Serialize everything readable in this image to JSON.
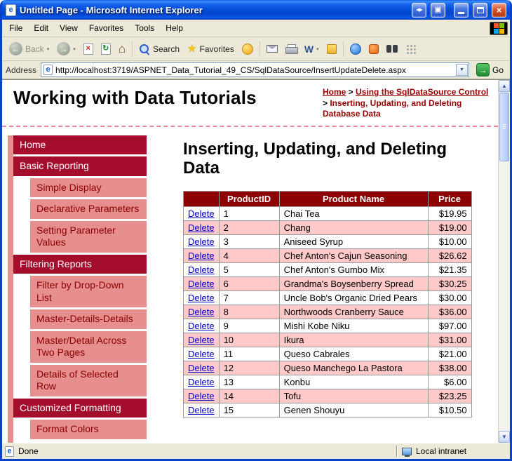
{
  "colors": {
    "titlebar_blue": "#0a50dc",
    "chrome_bg": "#ece9d8",
    "table_header_maroon": "#8b0000",
    "nav_header_red": "#a50d2d",
    "nav_sub_pink": "#e78f8f",
    "row_pink": "#ffc9c9",
    "breadcrumb_link": "#990000",
    "delete_link_blue": "#0000cc",
    "go_green": "#1e8c30"
  },
  "titlebar": {
    "title": "Untitled Page - Microsoft Internet Explorer"
  },
  "menu": {
    "items": [
      "File",
      "Edit",
      "View",
      "Favorites",
      "Tools",
      "Help"
    ]
  },
  "toolbar": {
    "back_label": "Back",
    "search_label": "Search",
    "favorites_label": "Favorites"
  },
  "address": {
    "label": "Address",
    "url": "http://localhost:3719/ASPNET_Data_Tutorial_49_CS/SqlDataSource/InsertUpdateDelete.aspx",
    "go_label": "Go"
  },
  "icons": {
    "favicon_letter": "e",
    "monitor_swap": "◀▶",
    "monitor": "▣",
    "close": "×",
    "back_arrow": "←",
    "forward_arrow": "→",
    "stop": "×",
    "refresh": "↻",
    "home": "⌂",
    "star": "★",
    "word": "W",
    "chevron_down": "▾",
    "dropdown_arrow": "▼",
    "go_arrow": "→",
    "scroll_up": "▲",
    "scroll_down": "▼"
  },
  "page": {
    "site_title": "Working with Data Tutorials",
    "breadcrumb": {
      "separator": " > ",
      "links": [
        {
          "label": "Home"
        },
        {
          "label": "Using the SqlDataSource Control"
        }
      ],
      "current": "Inserting, Updating, and Deleting Database Data"
    },
    "sidebar": {
      "items": [
        {
          "label": "Home",
          "level": 0
        },
        {
          "label": "Basic Reporting",
          "level": 0
        },
        {
          "label": "Simple Display",
          "level": 1
        },
        {
          "label": "Declarative Parameters",
          "level": 1
        },
        {
          "label": "Setting Parameter Values",
          "level": 1
        },
        {
          "label": "Filtering Reports",
          "level": 0
        },
        {
          "label": "Filter by Drop-Down List",
          "level": 1
        },
        {
          "label": "Master-Details-Details",
          "level": 1
        },
        {
          "label": "Master/Detail Across Two Pages",
          "level": 1
        },
        {
          "label": "Details of Selected Row",
          "level": 1
        },
        {
          "label": "Customized Formatting",
          "level": 0
        },
        {
          "label": "Format Colors",
          "level": 1
        }
      ]
    },
    "heading": "Inserting, Updating, and Deleting Data",
    "grid": {
      "delete_label": "Delete",
      "columns": [
        "",
        "ProductID",
        "Product Name",
        "Price"
      ],
      "rows": [
        {
          "id": 1,
          "name": "Chai Tea",
          "price": "$19.95"
        },
        {
          "id": 2,
          "name": "Chang",
          "price": "$19.00"
        },
        {
          "id": 3,
          "name": "Aniseed Syrup",
          "price": "$10.00"
        },
        {
          "id": 4,
          "name": "Chef Anton's Cajun Seasoning",
          "price": "$26.62"
        },
        {
          "id": 5,
          "name": "Chef Anton's Gumbo Mix",
          "price": "$21.35"
        },
        {
          "id": 6,
          "name": "Grandma's Boysenberry Spread",
          "price": "$30.25"
        },
        {
          "id": 7,
          "name": "Uncle Bob's Organic Dried Pears",
          "price": "$30.00"
        },
        {
          "id": 8,
          "name": "Northwoods Cranberry Sauce",
          "price": "$36.00"
        },
        {
          "id": 9,
          "name": "Mishi Kobe Niku",
          "price": "$97.00"
        },
        {
          "id": 10,
          "name": "Ikura",
          "price": "$31.00"
        },
        {
          "id": 11,
          "name": "Queso Cabrales",
          "price": "$21.00"
        },
        {
          "id": 12,
          "name": "Queso Manchego La Pastora",
          "price": "$38.00"
        },
        {
          "id": 13,
          "name": "Konbu",
          "price": "$6.00"
        },
        {
          "id": 14,
          "name": "Tofu",
          "price": "$23.25"
        },
        {
          "id": 15,
          "name": "Genen Shouyu",
          "price": "$10.50"
        }
      ]
    }
  },
  "statusbar": {
    "status": "Done",
    "zone": "Local intranet"
  }
}
